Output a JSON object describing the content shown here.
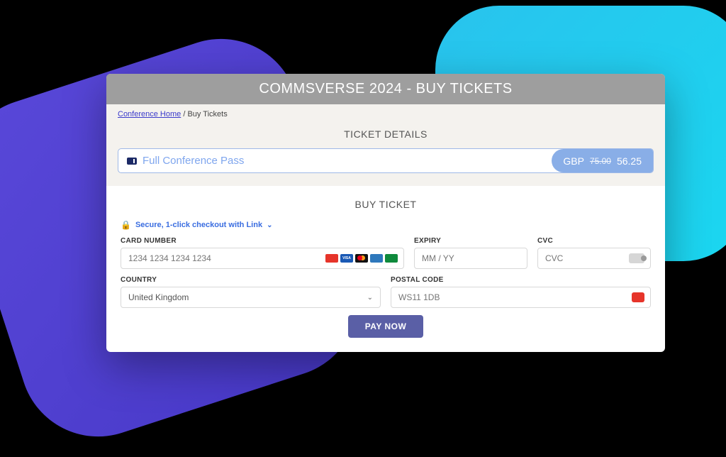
{
  "header": {
    "title": "COMMSVERSE 2024 - BUY TICKETS"
  },
  "breadcrumb": {
    "home": "Conference Home",
    "sep": " / ",
    "current": "Buy Tickets"
  },
  "ticket_details": {
    "heading": "TICKET DETAILS",
    "name": "Full Conference Pass",
    "currency": "GBP",
    "original": "75.00",
    "price": "56.25"
  },
  "buy": {
    "heading": "BUY TICKET",
    "secure_text": "Secure, 1-click checkout with Link",
    "card_label": "CARD NUMBER",
    "card_placeholder": "1234 1234 1234 1234",
    "expiry_label": "EXPIRY",
    "expiry_placeholder": "MM / YY",
    "cvc_label": "CVC",
    "cvc_placeholder": "CVC",
    "country_label": "COUNTRY",
    "country_value": "United Kingdom",
    "postal_label": "POSTAL CODE",
    "postal_placeholder": "WS11 1DB",
    "pay_label": "PAY NOW"
  }
}
